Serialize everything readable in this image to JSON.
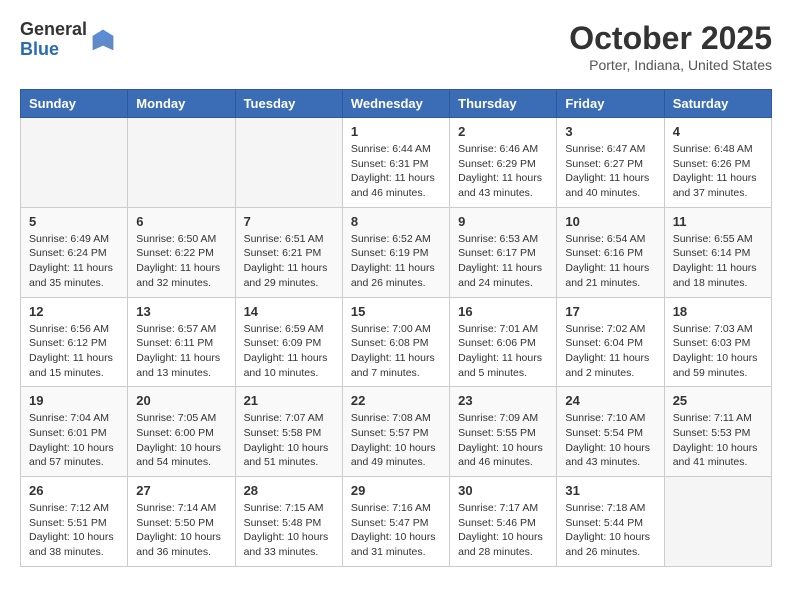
{
  "header": {
    "logo": {
      "general": "General",
      "blue": "Blue"
    },
    "title": "October 2025",
    "subtitle": "Porter, Indiana, United States"
  },
  "weekdays": [
    "Sunday",
    "Monday",
    "Tuesday",
    "Wednesday",
    "Thursday",
    "Friday",
    "Saturday"
  ],
  "weeks": [
    [
      {
        "day": null,
        "content": ""
      },
      {
        "day": null,
        "content": ""
      },
      {
        "day": null,
        "content": ""
      },
      {
        "day": 1,
        "content": "Sunrise: 6:44 AM\nSunset: 6:31 PM\nDaylight: 11 hours and 46 minutes."
      },
      {
        "day": 2,
        "content": "Sunrise: 6:46 AM\nSunset: 6:29 PM\nDaylight: 11 hours and 43 minutes."
      },
      {
        "day": 3,
        "content": "Sunrise: 6:47 AM\nSunset: 6:27 PM\nDaylight: 11 hours and 40 minutes."
      },
      {
        "day": 4,
        "content": "Sunrise: 6:48 AM\nSunset: 6:26 PM\nDaylight: 11 hours and 37 minutes."
      }
    ],
    [
      {
        "day": 5,
        "content": "Sunrise: 6:49 AM\nSunset: 6:24 PM\nDaylight: 11 hours and 35 minutes."
      },
      {
        "day": 6,
        "content": "Sunrise: 6:50 AM\nSunset: 6:22 PM\nDaylight: 11 hours and 32 minutes."
      },
      {
        "day": 7,
        "content": "Sunrise: 6:51 AM\nSunset: 6:21 PM\nDaylight: 11 hours and 29 minutes."
      },
      {
        "day": 8,
        "content": "Sunrise: 6:52 AM\nSunset: 6:19 PM\nDaylight: 11 hours and 26 minutes."
      },
      {
        "day": 9,
        "content": "Sunrise: 6:53 AM\nSunset: 6:17 PM\nDaylight: 11 hours and 24 minutes."
      },
      {
        "day": 10,
        "content": "Sunrise: 6:54 AM\nSunset: 6:16 PM\nDaylight: 11 hours and 21 minutes."
      },
      {
        "day": 11,
        "content": "Sunrise: 6:55 AM\nSunset: 6:14 PM\nDaylight: 11 hours and 18 minutes."
      }
    ],
    [
      {
        "day": 12,
        "content": "Sunrise: 6:56 AM\nSunset: 6:12 PM\nDaylight: 11 hours and 15 minutes."
      },
      {
        "day": 13,
        "content": "Sunrise: 6:57 AM\nSunset: 6:11 PM\nDaylight: 11 hours and 13 minutes."
      },
      {
        "day": 14,
        "content": "Sunrise: 6:59 AM\nSunset: 6:09 PM\nDaylight: 11 hours and 10 minutes."
      },
      {
        "day": 15,
        "content": "Sunrise: 7:00 AM\nSunset: 6:08 PM\nDaylight: 11 hours and 7 minutes."
      },
      {
        "day": 16,
        "content": "Sunrise: 7:01 AM\nSunset: 6:06 PM\nDaylight: 11 hours and 5 minutes."
      },
      {
        "day": 17,
        "content": "Sunrise: 7:02 AM\nSunset: 6:04 PM\nDaylight: 11 hours and 2 minutes."
      },
      {
        "day": 18,
        "content": "Sunrise: 7:03 AM\nSunset: 6:03 PM\nDaylight: 10 hours and 59 minutes."
      }
    ],
    [
      {
        "day": 19,
        "content": "Sunrise: 7:04 AM\nSunset: 6:01 PM\nDaylight: 10 hours and 57 minutes."
      },
      {
        "day": 20,
        "content": "Sunrise: 7:05 AM\nSunset: 6:00 PM\nDaylight: 10 hours and 54 minutes."
      },
      {
        "day": 21,
        "content": "Sunrise: 7:07 AM\nSunset: 5:58 PM\nDaylight: 10 hours and 51 minutes."
      },
      {
        "day": 22,
        "content": "Sunrise: 7:08 AM\nSunset: 5:57 PM\nDaylight: 10 hours and 49 minutes."
      },
      {
        "day": 23,
        "content": "Sunrise: 7:09 AM\nSunset: 5:55 PM\nDaylight: 10 hours and 46 minutes."
      },
      {
        "day": 24,
        "content": "Sunrise: 7:10 AM\nSunset: 5:54 PM\nDaylight: 10 hours and 43 minutes."
      },
      {
        "day": 25,
        "content": "Sunrise: 7:11 AM\nSunset: 5:53 PM\nDaylight: 10 hours and 41 minutes."
      }
    ],
    [
      {
        "day": 26,
        "content": "Sunrise: 7:12 AM\nSunset: 5:51 PM\nDaylight: 10 hours and 38 minutes."
      },
      {
        "day": 27,
        "content": "Sunrise: 7:14 AM\nSunset: 5:50 PM\nDaylight: 10 hours and 36 minutes."
      },
      {
        "day": 28,
        "content": "Sunrise: 7:15 AM\nSunset: 5:48 PM\nDaylight: 10 hours and 33 minutes."
      },
      {
        "day": 29,
        "content": "Sunrise: 7:16 AM\nSunset: 5:47 PM\nDaylight: 10 hours and 31 minutes."
      },
      {
        "day": 30,
        "content": "Sunrise: 7:17 AM\nSunset: 5:46 PM\nDaylight: 10 hours and 28 minutes."
      },
      {
        "day": 31,
        "content": "Sunrise: 7:18 AM\nSunset: 5:44 PM\nDaylight: 10 hours and 26 minutes."
      },
      {
        "day": null,
        "content": ""
      }
    ]
  ]
}
